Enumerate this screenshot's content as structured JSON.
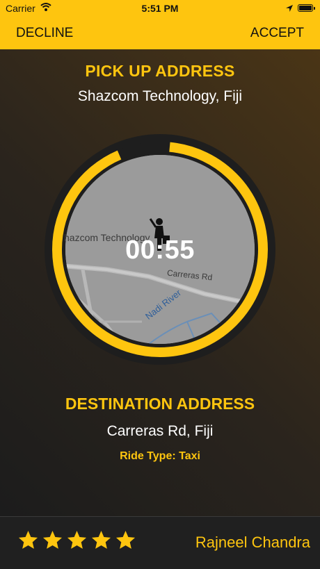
{
  "status_bar": {
    "carrier": "Carrier",
    "time": "5:51 PM"
  },
  "nav": {
    "decline_label": "DECLINE",
    "accept_label": "ACCEPT"
  },
  "pickup": {
    "title": "PICK UP ADDRESS",
    "address": "Shazcom Technology, Fiji"
  },
  "map": {
    "place_label": "hazcom Technology",
    "road_label": "Carreras Rd",
    "river_label": "Nadi River"
  },
  "timer": {
    "value": "00:55",
    "progress_fraction": 0.92
  },
  "destination": {
    "title": "DESTINATION ADDRESS",
    "address": "Carreras Rd,  Fiji"
  },
  "ride_type": "Ride Type: Taxi",
  "driver": {
    "name": "Rajneel Chandra",
    "rating": 5,
    "rating_max": 5
  },
  "colors": {
    "accent": "#fec50f",
    "footer_bg": "#202020",
    "map_bg": "#9a9a9a"
  }
}
